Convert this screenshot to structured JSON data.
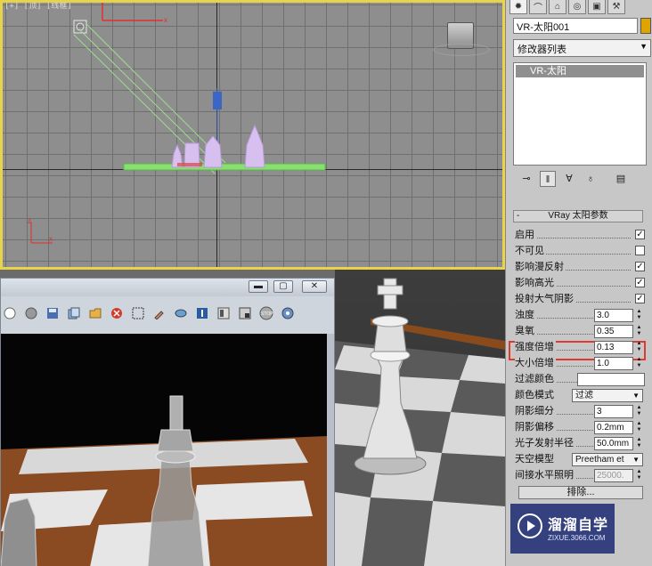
{
  "viewport_top": {
    "label": "[+] [顶] [线框]"
  },
  "command_panel": {
    "tabs": [
      "create",
      "modify",
      "hierarchy",
      "motion",
      "display",
      "utilities"
    ],
    "object_name": "VR-太阳001",
    "object_color": "#e0a400",
    "modifier_list": "修改器列表",
    "stack_items": [
      "VR-太阳"
    ],
    "rollout_title": "VRay 太阳参数",
    "params": [
      {
        "label": "启用",
        "type": "check",
        "checked": true
      },
      {
        "label": "不可见",
        "type": "check",
        "checked": false
      },
      {
        "label": "影响漫反射",
        "type": "check",
        "checked": true
      },
      {
        "label": "影响高光",
        "type": "check",
        "checked": true
      },
      {
        "label": "投射大气阴影",
        "type": "check",
        "checked": true
      },
      {
        "label": "浊度",
        "type": "spin",
        "value": "3.0"
      },
      {
        "label": "臭氧",
        "type": "spin",
        "value": "0.35"
      },
      {
        "label": "强度倍增",
        "type": "spin",
        "value": "0.13"
      },
      {
        "label": "大小倍增",
        "type": "spin",
        "value": "1.0"
      },
      {
        "label": "过滤颜色",
        "type": "color",
        "value": "#ffffff"
      },
      {
        "label": "颜色模式",
        "type": "dropdown",
        "value": "过滤"
      },
      {
        "label": "阴影细分",
        "type": "spin",
        "value": "3"
      },
      {
        "label": "阴影偏移",
        "type": "spin",
        "value": "0.2mm"
      },
      {
        "label": "光子发射半径",
        "type": "spin",
        "value": "50.0mm"
      },
      {
        "label": "天空模型",
        "type": "dropdown",
        "value": "Preetham et"
      },
      {
        "label": "间接水平照明",
        "type": "spin",
        "value": "25000.",
        "disabled": true
      }
    ],
    "exclude_button": "排除..."
  },
  "render_window": {
    "controls": [
      "▬",
      "▢",
      "✕"
    ],
    "toolbar_icons": [
      "circle-white-icon",
      "circle-gray-icon",
      "save-icon",
      "copy-icon",
      "folder-icon",
      "stop-red-icon",
      "region-icon",
      "picker-icon",
      "lens-icon",
      "compare-icon",
      "channels-icon",
      "history-icon",
      "stop-icon",
      "settings-icon"
    ]
  },
  "watermark": {
    "title": "溜溜自学",
    "subtitle": "ZIXUE.3066.COM"
  }
}
